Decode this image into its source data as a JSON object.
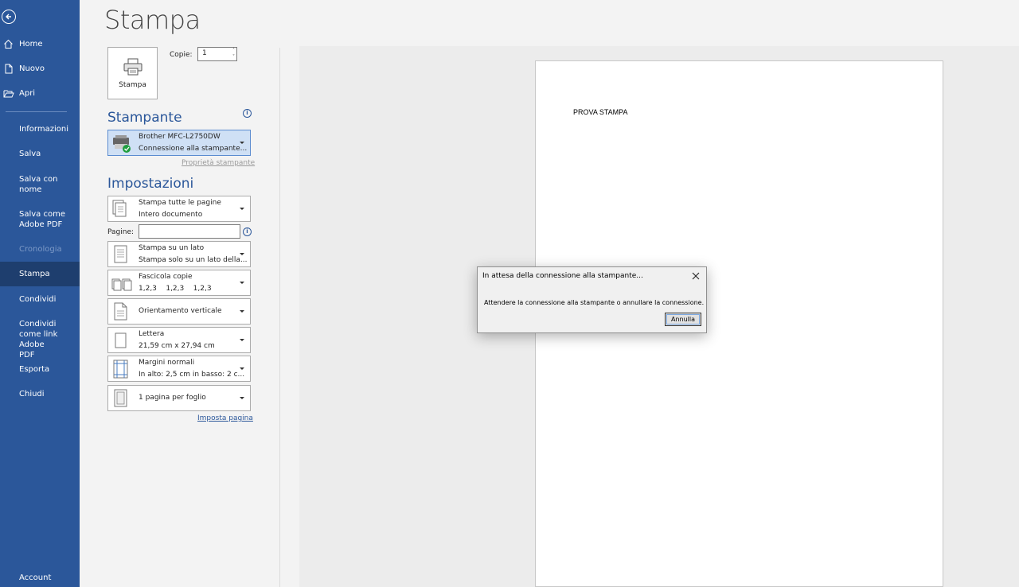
{
  "sidebar": {
    "back_icon": "back-arrow-icon",
    "items": [
      {
        "label": "Home",
        "icon": "home-icon"
      },
      {
        "label": "Nuovo",
        "icon": "new-document-icon"
      },
      {
        "label": "Apri",
        "icon": "open-folder-icon"
      },
      {
        "label": "Informazioni"
      },
      {
        "label": "Salva"
      },
      {
        "label": "Salva con nome"
      },
      {
        "label": "Salva come Adobe PDF"
      },
      {
        "label": "Cronologia",
        "state": "disabled"
      },
      {
        "label": "Stampa",
        "state": "active"
      },
      {
        "label": "Condividi"
      },
      {
        "label": "Condividi come link Adobe PDF"
      },
      {
        "label": "Esporta"
      },
      {
        "label": "Chiudi"
      },
      {
        "label": "Account"
      }
    ]
  },
  "print": {
    "title": "Stampa",
    "button_label": "Stampa",
    "copies_label": "Copie:",
    "copies_value": "1"
  },
  "printer": {
    "section_title": "Stampante",
    "name": "Brother MFC-L2750DW",
    "status": "Connessione alla stampante...",
    "properties_link": "Proprietà stampante"
  },
  "settings": {
    "section_title": "Impostazioni",
    "pages_label": "Pagine:",
    "pages_value": "",
    "dropdowns": [
      {
        "line1": "Stampa tutte le pagine",
        "line2": "Intero documento"
      },
      {
        "line1": "Stampa su un lato",
        "line2": "Stampa solo su un lato della..."
      },
      {
        "line1": "Fascicola copie",
        "line2": "1,2,3    1,2,3    1,2,3"
      },
      {
        "line1": "Orientamento verticale",
        "line2": ""
      },
      {
        "line1": "Lettera",
        "line2": "21,59 cm x 27,94 cm"
      },
      {
        "line1": "Margini normali",
        "line2": "In alto: 2,5 cm in basso: 2 c..."
      },
      {
        "line1": "1 pagina per foglio",
        "line2": ""
      }
    ],
    "page_setup_link": "Imposta pagina"
  },
  "preview": {
    "document_text": "PROVA STAMPA"
  },
  "dialog": {
    "title": "In attesa della connessione alla stampante...",
    "message": "Attendere la connessione alla stampante o annullare la connessione.",
    "cancel_label": "Annulla"
  },
  "colors": {
    "sidebar": "#2b579a",
    "sidebar_active": "#1e3e6e",
    "accent": "#2b579a"
  }
}
